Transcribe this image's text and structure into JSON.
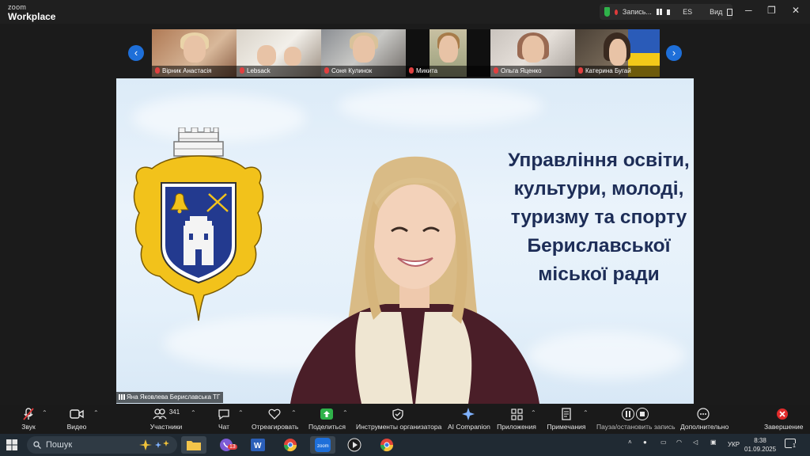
{
  "window": {
    "brand_small": "zoom",
    "brand_name": "Workplace",
    "recording_label": "Запись...",
    "language": "ES",
    "view_label": "Вид",
    "controls": [
      "─",
      "❐",
      "✕"
    ]
  },
  "participants": [
    {
      "name": "Вірник Анастасія",
      "muted": true
    },
    {
      "name": "Lebsack",
      "muted": true
    },
    {
      "name": "Соня Кулинок",
      "muted": true
    },
    {
      "name": "Микита",
      "muted": true
    },
    {
      "name": "Ольга Яценко",
      "muted": true
    },
    {
      "name": "Катерина Бугай",
      "muted": true
    }
  ],
  "share": {
    "slide_title_lines": [
      "Управління освіти,",
      "культури, молоді,",
      "туризму та спорту",
      "Бериславської",
      "міської ради"
    ],
    "speaker": "Яна Яковлева Бериславська ТГ"
  },
  "toolbar": {
    "audio": "Звук",
    "video": "Видео",
    "participants": "Участники",
    "participants_count": "341",
    "chat": "Чат",
    "react": "Отреагировать",
    "share": "Поделиться",
    "host_tools": "Инструменты организатора",
    "ai": "AI Companion",
    "apps": "Приложения",
    "notes": "Примечания",
    "record": "Пауза/остановить запись",
    "more": "Дополнительно",
    "end": "Завершение"
  },
  "taskbar": {
    "search_placeholder": "Пошук",
    "language": "УКР",
    "time": "8:38",
    "date": "01.09.2025",
    "notification_count": "1",
    "viber_badge": "13"
  },
  "colors": {
    "accent_blue": "#1e6fd9",
    "share_green": "#2fb24a",
    "end_red": "#e02b2b",
    "slide_text": "#1d2d57"
  }
}
